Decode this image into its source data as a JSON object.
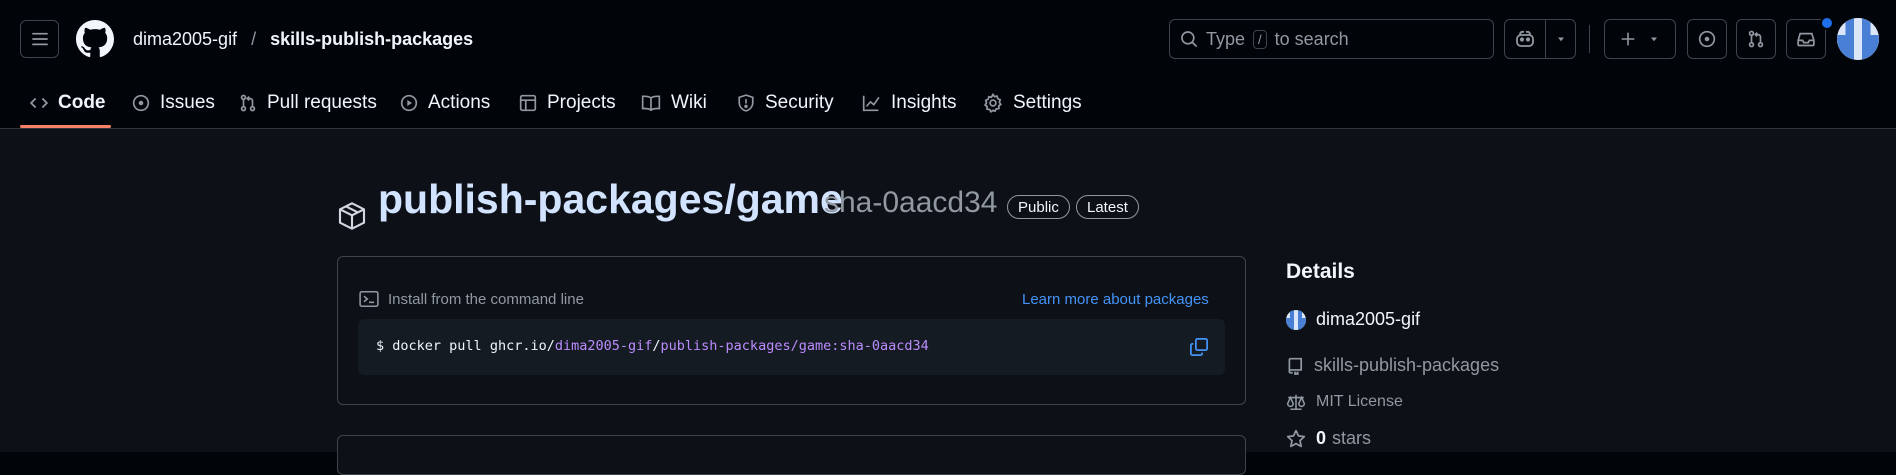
{
  "header": {
    "owner": "dima2005-gif",
    "separator": "/",
    "repo": "skills-publish-packages",
    "search_placeholder_prefix": "Type",
    "search_shortcut": "/",
    "search_placeholder_suffix": "to search"
  },
  "tabs": [
    {
      "label": "Code",
      "icon": "code-icon"
    },
    {
      "label": "Issues",
      "icon": "issue-icon"
    },
    {
      "label": "Pull requests",
      "icon": "pull-request-icon"
    },
    {
      "label": "Actions",
      "icon": "play-icon"
    },
    {
      "label": "Projects",
      "icon": "table-icon"
    },
    {
      "label": "Wiki",
      "icon": "book-icon"
    },
    {
      "label": "Security",
      "icon": "shield-icon"
    },
    {
      "label": "Insights",
      "icon": "graph-icon"
    },
    {
      "label": "Settings",
      "icon": "gear-icon"
    }
  ],
  "package": {
    "name": "publish-packages/game",
    "version": "sha-0aacd34",
    "badge_public": "Public",
    "badge_latest": "Latest"
  },
  "install": {
    "title": "Install from the command line",
    "learn_more": "Learn more about packages",
    "cmd_prompt": "$",
    "cmd_prefix": "docker pull ghcr.io/",
    "cmd_owner": "dima2005-gif",
    "cmd_sep": "/",
    "cmd_image": "publish-packages/game:sha-0aacd34"
  },
  "details": {
    "heading": "Details",
    "owner": "dima2005-gif",
    "repo": "skills-publish-packages",
    "license": "MIT License",
    "stars_count": "0",
    "stars_label": "stars"
  },
  "colors": {
    "background": "#010409",
    "content_background": "#0d1117",
    "active_tab_underline": "#f78166",
    "link": "#4493f8",
    "accent_purple": "#bc8cff",
    "notification_dot": "#1f6feb"
  }
}
